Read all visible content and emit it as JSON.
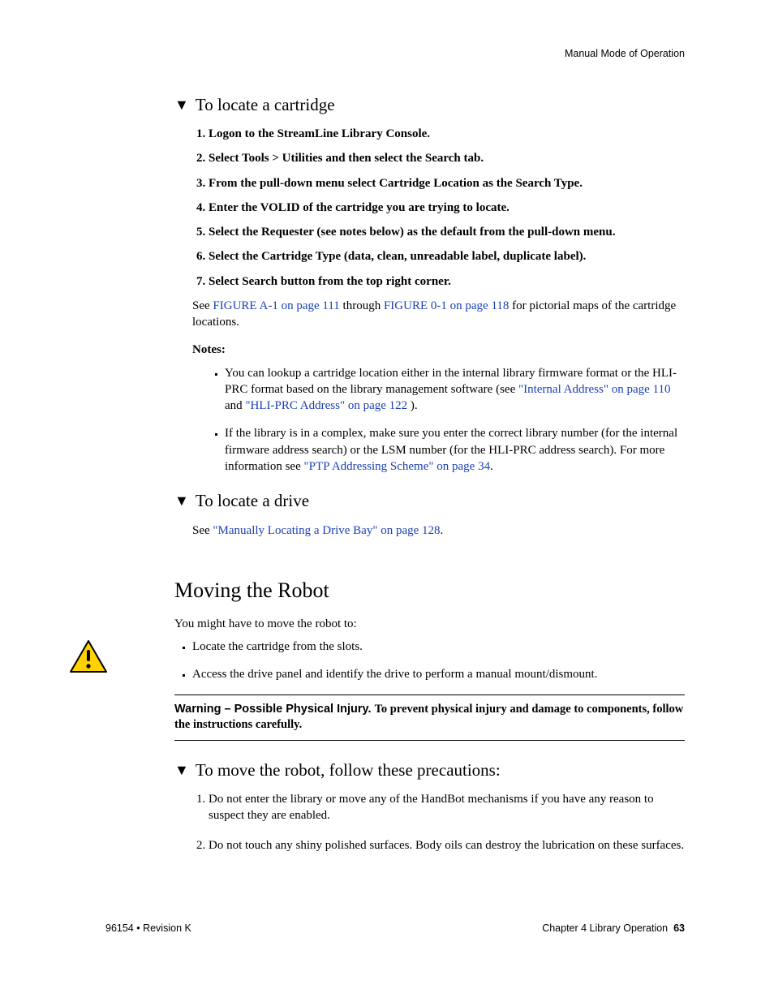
{
  "header": {
    "running": "Manual Mode of Operation"
  },
  "proc1": {
    "title": "To locate a cartridge",
    "steps": [
      "Logon to the StreamLine Library Console.",
      "Select Tools > Utilities and then select the Search tab.",
      "From the pull-down menu select Cartridge Location as the Search Type.",
      "Enter the VOLID of the cartridge you are trying to locate.",
      "Select the Requester (see notes below) as the default from the pull-down menu.",
      "Select the Cartridge Type (data, clean, unreadable label, duplicate label).",
      "Select Search button from the top right corner."
    ],
    "after7_pre": "See ",
    "after7_link1": "FIGURE A-1 on page 111",
    "after7_mid": " through ",
    "after7_link2": "FIGURE 0-1 on page 118",
    "after7_post": " for pictorial maps of the cartridge locations.",
    "notes_label": "Notes:",
    "note1_pre": "You can lookup a cartridge location either in the internal library firmware format or the HLI-PRC format based on the library management software (see ",
    "note1_link1": "\"Internal Address\" on page 110",
    "note1_mid": " and ",
    "note1_link2": "\"HLI-PRC Address\" on page 122",
    "note1_post": " ).",
    "note2_pre": "If the library is in a complex, make sure you enter the correct library number (for the internal firmware address search) or the LSM number (for the HLI-PRC address search). For more information see ",
    "note2_link": "\"PTP Addressing Scheme\" on page 34",
    "note2_post": "."
  },
  "proc2": {
    "title": "To locate a drive",
    "pre": "See ",
    "link": "\"Manually Locating a Drive Bay\" on page 128",
    "post": "."
  },
  "section": {
    "title": "Moving the Robot",
    "intro": "You might have to move the robot to:",
    "bullets": [
      "Locate the cartridge from the slots.",
      "Access the drive panel and identify the drive to perform a manual mount/dismount."
    ]
  },
  "warning": {
    "lead": "Warning – Possible Physical Injury.  ",
    "rest": "To prevent physical injury and damage to components, follow the instructions carefully."
  },
  "proc3": {
    "title": "To move the robot, follow these precautions:",
    "items": [
      "Do not enter the library or move any of the HandBot mechanisms if you have any reason to suspect they are enabled.",
      "Do not touch any shiny polished surfaces. Body oils can destroy the lubrication on these surfaces."
    ]
  },
  "footer": {
    "left": "96154 • Revision K",
    "right_text": "Chapter 4 Library Operation",
    "page": "63"
  }
}
